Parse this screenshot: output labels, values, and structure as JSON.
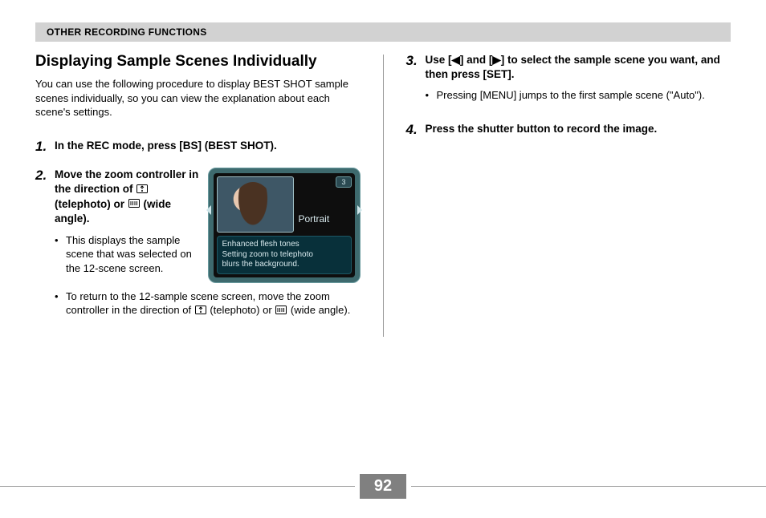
{
  "header": {
    "title": "OTHER RECORDING FUNCTIONS"
  },
  "page_number": "92",
  "left": {
    "heading": "Displaying Sample Scenes Individually",
    "intro": "You can use the following procedure to display BEST SHOT sample scenes individually, so you can view the explanation about each scene's settings.",
    "step1": {
      "num": "1.",
      "title": "In the REC mode, press [BS] (BEST SHOT)."
    },
    "step2": {
      "num": "2.",
      "title_pre": "Move the zoom controller in the direction of ",
      "title_mid": " (telephoto) or ",
      "title_post": " (wide angle).",
      "bullet1": "This displays the sample scene that was selected on the 12-scene screen.",
      "bullet2_pre": "To return to the 12-sample scene screen, move the zoom controller in the direction of ",
      "bullet2_mid": " (telephoto) or ",
      "bullet2_post": " (wide angle)."
    },
    "preview": {
      "badge": "3",
      "scene_name": "Portrait",
      "caption_l1": "Enhanced flesh tones",
      "caption_l2": "Setting zoom to telephoto",
      "caption_l3": "blurs the background."
    }
  },
  "right": {
    "step3": {
      "num": "3.",
      "title": "Use [◀] and [▶] to select the sample scene you want, and then press [SET].",
      "bullet1": "Pressing [MENU] jumps to the first sample scene (\"Auto\")."
    },
    "step4": {
      "num": "4.",
      "title": "Press the shutter button to record the image."
    }
  },
  "icons": {
    "telephoto_alt": "telephoto-icon",
    "wide_alt": "wide-angle-icon"
  }
}
